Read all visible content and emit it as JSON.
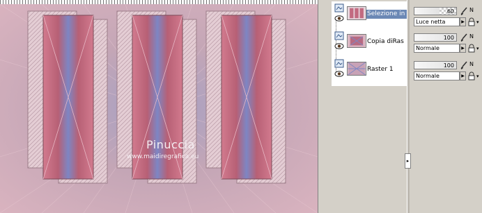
{
  "canvas": {
    "watermark_title": "Pinuccia",
    "watermark_url": "www.maidiregrafica.eu"
  },
  "layers": [
    {
      "name": "Selezione in",
      "selected": true,
      "type_icon": "raster-layer-icon",
      "visibility_icon": "eye-icon",
      "opacity": "60",
      "blend_mode": "Luce netta"
    },
    {
      "name": "Copia diRas",
      "selected": false,
      "type_icon": "raster-layer-icon",
      "visibility_icon": "eye-icon",
      "opacity": "100",
      "blend_mode": "Normale"
    },
    {
      "name": "Raster 1",
      "selected": false,
      "type_icon": "raster-layer-icon",
      "visibility_icon": "eye-icon",
      "opacity": "100",
      "blend_mode": "Normale"
    }
  ],
  "props": {
    "n_label": "N",
    "lock_icon": "lock-icon",
    "brush_icon": "brush-icon"
  },
  "panel": {
    "collapse_glyph": "▸"
  },
  "colors": {
    "selection": "#6b88b5",
    "panel_bg": "#d4d0c8",
    "art_pink": "#c97a8e",
    "art_blue": "#7f86c0"
  }
}
